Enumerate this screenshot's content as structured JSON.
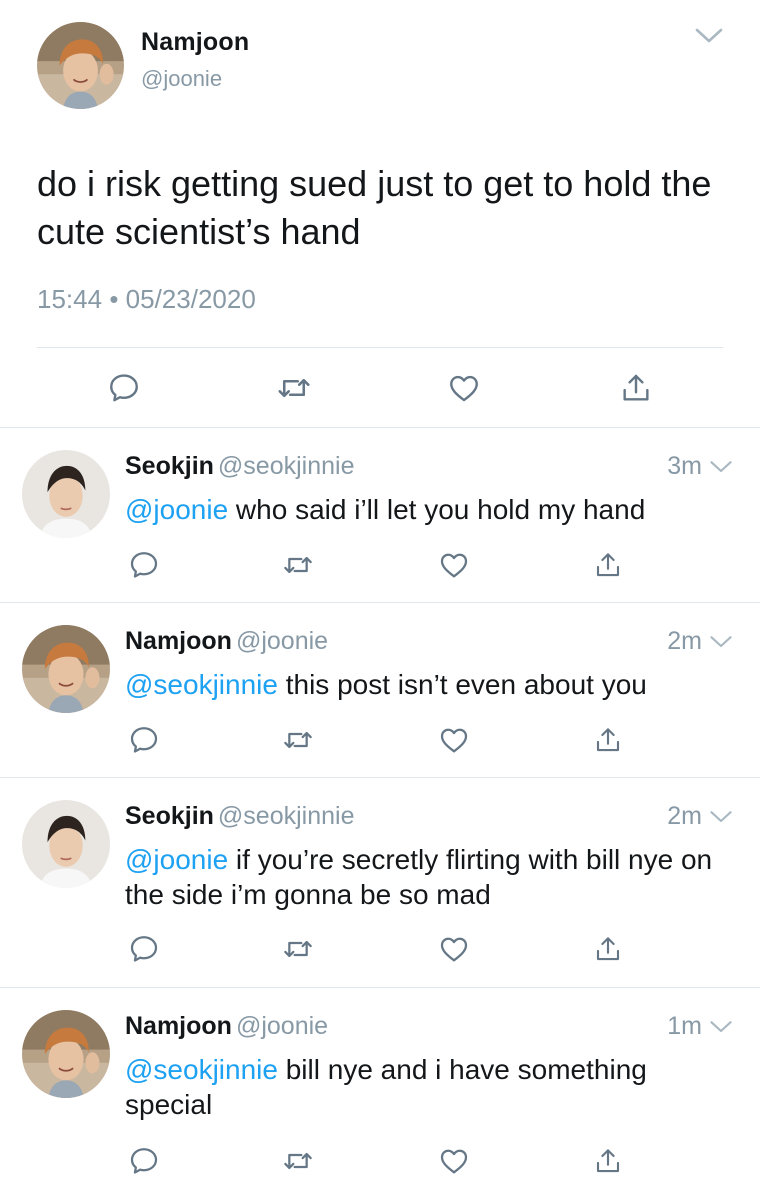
{
  "main_tweet": {
    "name": "Namjoon",
    "handle": "@joonie",
    "text": "do i risk getting sued just to get to hold the cute scientist’s hand",
    "time": "15:44",
    "separator": "•",
    "date": "05/23/2020"
  },
  "replies": [
    {
      "name": "Seokjin",
      "handle": "@seokjinnie",
      "time": "3m",
      "mention": "@joonie",
      "text": " who said i’ll let you hold my hand"
    },
    {
      "name": "Namjoon",
      "handle": "@joonie",
      "time": "2m",
      "mention": "@seokjinnie",
      "text": " this post isn’t even about you"
    },
    {
      "name": "Seokjin",
      "handle": "@seokjinnie",
      "time": "2m",
      "mention": "@joonie",
      "text": " if you’re secretly flirting with bill nye on the side i’m gonna be so mad"
    },
    {
      "name": "Namjoon",
      "handle": "@joonie",
      "time": "1m",
      "mention": "@seokjinnie",
      "text": " bill nye and i have something special"
    }
  ],
  "icons": {
    "reply": "reply-icon",
    "retweet": "retweet-icon",
    "like": "heart-icon",
    "share": "share-icon",
    "more": "chevron-down-icon"
  },
  "colors": {
    "text": "#14171a",
    "secondary": "#8899a6",
    "mention": "#1da1f2",
    "divider": "#e1e8ed",
    "icon": "#657786"
  }
}
